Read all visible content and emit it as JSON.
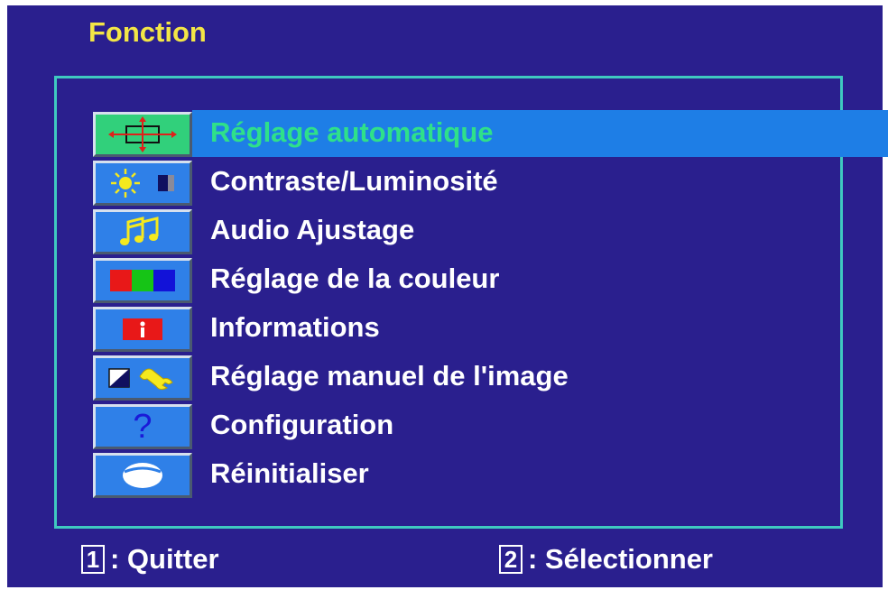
{
  "header": {
    "title": "Fonction"
  },
  "menu": {
    "items": [
      {
        "label": "Réglage automatique",
        "icon": "auto-adjust-icon",
        "selected": true
      },
      {
        "label": "Contraste/Luminosité",
        "icon": "brightness-contrast-icon",
        "selected": false
      },
      {
        "label": "Audio Ajustage",
        "icon": "music-notes-icon",
        "selected": false
      },
      {
        "label": "Réglage de la couleur",
        "icon": "rgb-color-icon",
        "selected": false
      },
      {
        "label": "Informations",
        "icon": "info-icon",
        "selected": false
      },
      {
        "label": "Réglage manuel de l'image",
        "icon": "manual-image-wrench-icon",
        "selected": false
      },
      {
        "label": "Configuration",
        "icon": "question-mark-icon",
        "selected": false
      },
      {
        "label": "Réinitialiser",
        "icon": "reset-icon",
        "selected": false
      }
    ]
  },
  "footer": {
    "quit": {
      "key": "1",
      "label": ": Quitter"
    },
    "select": {
      "key": "2",
      "label": ": Sélectionner"
    }
  },
  "colors": {
    "background": "#2a1f8e",
    "title": "#f3e646",
    "frame": "#3fc9c0",
    "selected_row": "#1e7ee6",
    "selected_text": "#2fe08a",
    "icon_box": "#2f80e8"
  }
}
